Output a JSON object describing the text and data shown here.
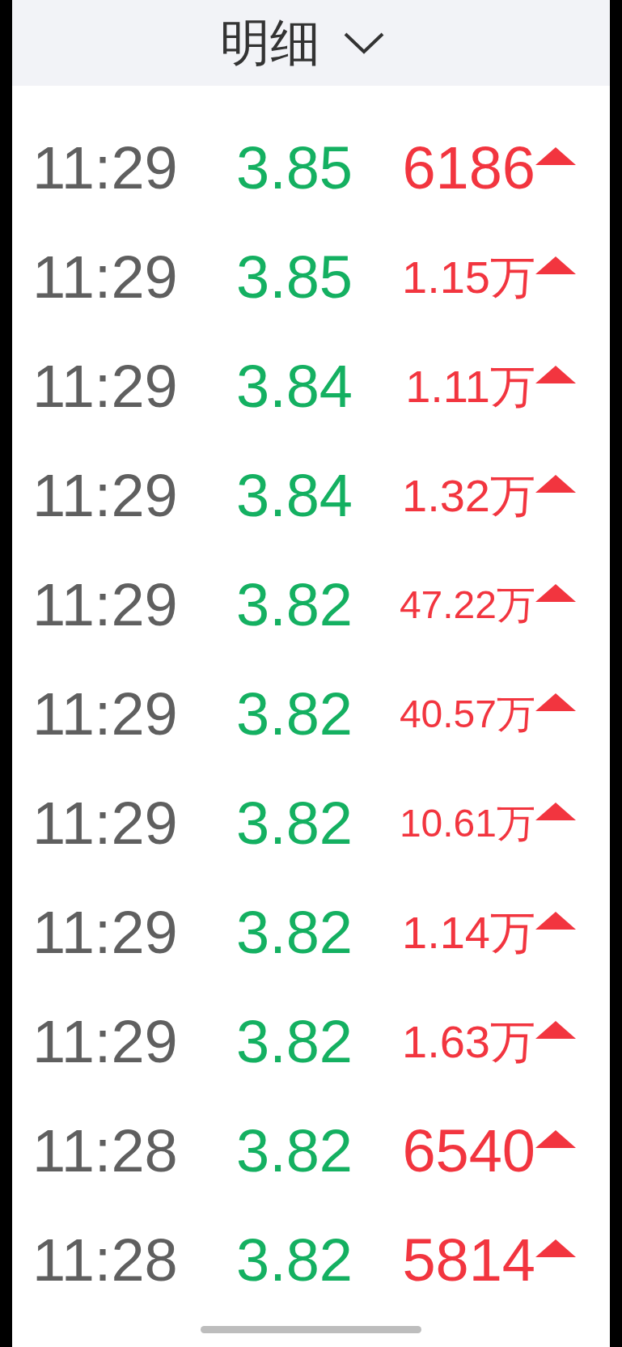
{
  "header": {
    "title": "明细"
  },
  "rows": [
    {
      "time": "11:29",
      "price": "3.85",
      "volume": "6186",
      "kind": "up"
    },
    {
      "time": "11:29",
      "price": "3.85",
      "volume": "1.15万",
      "kind": "up"
    },
    {
      "time": "11:29",
      "price": "3.84",
      "volume": "1.11万",
      "kind": "up"
    },
    {
      "time": "11:29",
      "price": "3.84",
      "volume": "1.32万",
      "kind": "up"
    },
    {
      "time": "11:29",
      "price": "3.82",
      "volume": "47.22万",
      "kind": "up"
    },
    {
      "time": "11:29",
      "price": "3.82",
      "volume": "40.57万",
      "kind": "up"
    },
    {
      "time": "11:29",
      "price": "3.82",
      "volume": "10.61万",
      "kind": "up"
    },
    {
      "time": "11:29",
      "price": "3.82",
      "volume": "1.14万",
      "kind": "up"
    },
    {
      "time": "11:29",
      "price": "3.82",
      "volume": "1.63万",
      "kind": "up"
    },
    {
      "time": "11:28",
      "price": "3.82",
      "volume": "6540",
      "kind": "up"
    },
    {
      "time": "11:28",
      "price": "3.82",
      "volume": "5814",
      "kind": "up"
    }
  ]
}
